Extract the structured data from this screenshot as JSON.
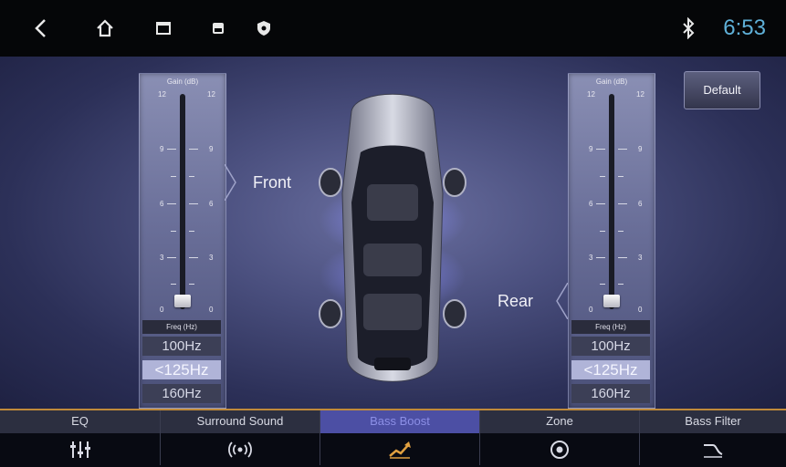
{
  "status_bar": {
    "time": "6:53",
    "icons": [
      "back-arrow-icon",
      "home-icon",
      "recent-apps-icon",
      "screenshot-icon",
      "shield-icon",
      "bluetooth-icon"
    ],
    "time_color": "#5fb0d8"
  },
  "front_panel": {
    "title": "Gain (dB)",
    "scale": [
      "12",
      "9",
      "6",
      "3",
      "0"
    ],
    "gain_value": 0,
    "freq_label": "Freq (Hz)",
    "freqs": [
      "100Hz",
      "<125Hz",
      "160Hz"
    ],
    "selected_freq": "<125Hz"
  },
  "rear_panel": {
    "title": "Gain (dB)",
    "scale": [
      "12",
      "9",
      "6",
      "3",
      "0"
    ],
    "gain_value": 0,
    "freq_label": "Freq (Hz)",
    "freqs": [
      "100Hz",
      "<125Hz",
      "160Hz"
    ],
    "selected_freq": "<125Hz"
  },
  "labels": {
    "front": "Front",
    "rear": "Rear"
  },
  "default_button": "Default",
  "tabs": [
    {
      "label": "EQ",
      "icon": "equalizer-icon"
    },
    {
      "label": "Surround Sound",
      "icon": "surround-icon"
    },
    {
      "label": "Bass Boost",
      "icon": "bass-boost-icon",
      "active": true
    },
    {
      "label": "Zone",
      "icon": "zone-icon"
    },
    {
      "label": "Bass Filter",
      "icon": "bass-filter-icon"
    }
  ],
  "colors": {
    "accent": "#4c4fa4",
    "tab_border": "#c08a3a",
    "active_text": "#8c8fe6"
  }
}
